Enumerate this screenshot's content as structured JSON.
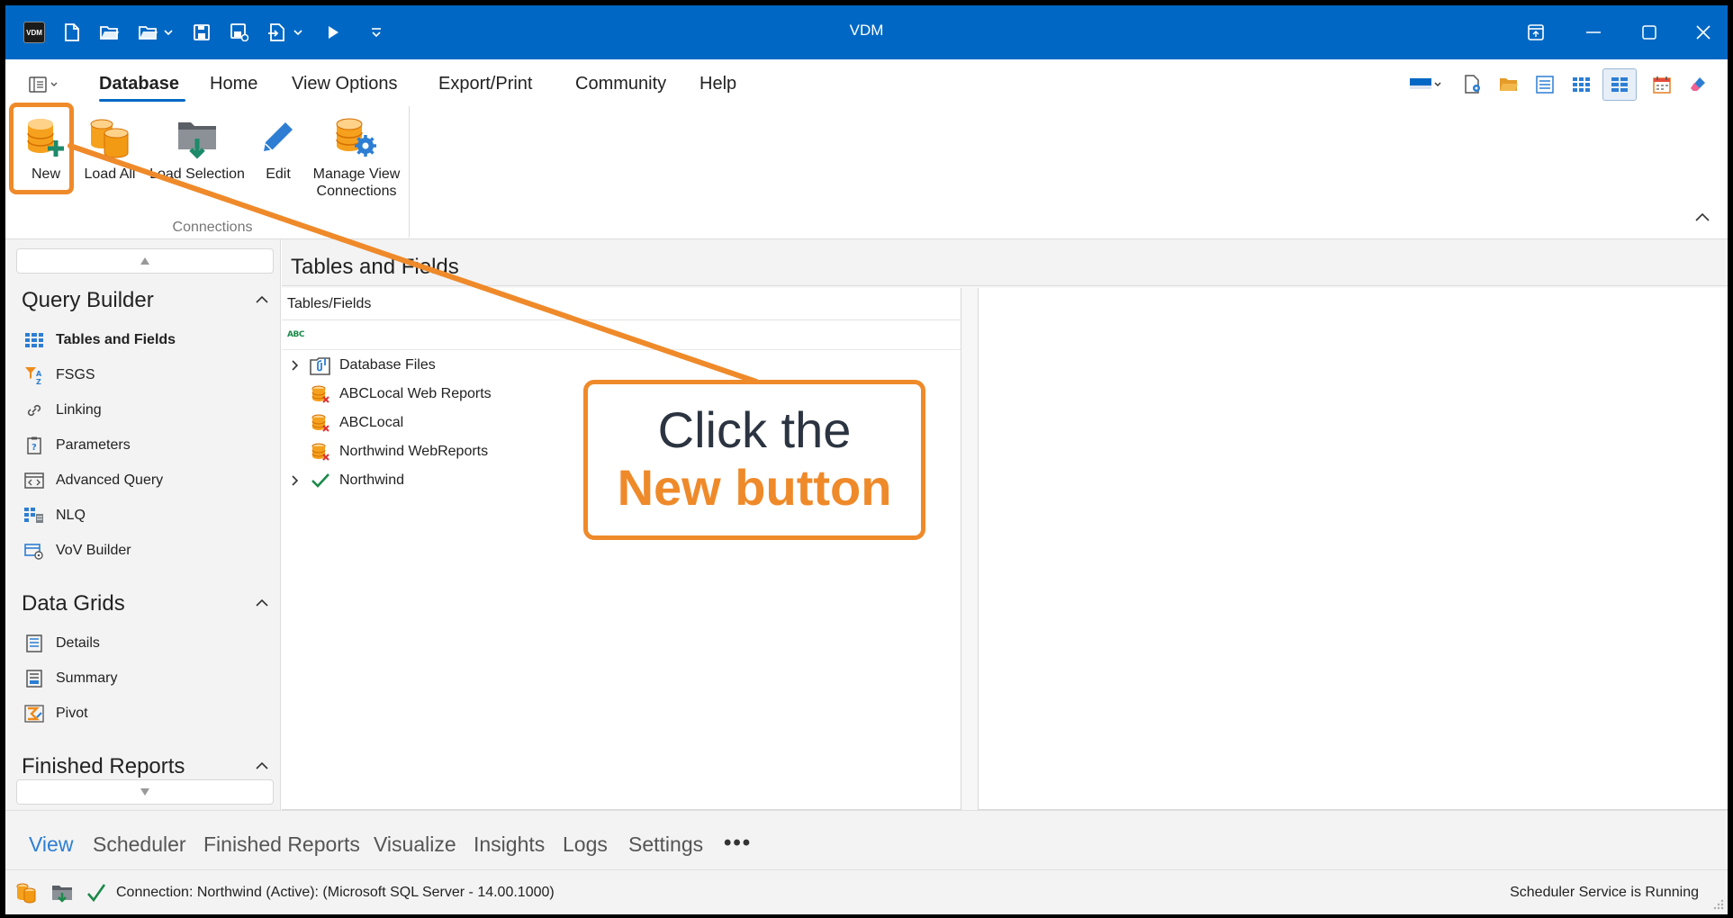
{
  "window": {
    "title": "VDM",
    "app_logo": "VDM"
  },
  "ribbon_tabs": [
    {
      "label": "Database"
    },
    {
      "label": "Home"
    },
    {
      "label": "View Options"
    },
    {
      "label": "Export/Print"
    },
    {
      "label": "Community"
    },
    {
      "label": "Help"
    }
  ],
  "ribbon": {
    "buttons": [
      {
        "label": "New"
      },
      {
        "label": "Load All"
      },
      {
        "label": "Load Selection"
      },
      {
        "label": "Edit"
      },
      {
        "label": "Manage View",
        "label2": "Connections"
      }
    ],
    "group_label": "Connections"
  },
  "nav": {
    "sections": [
      {
        "title": "Query Builder",
        "items": [
          "Tables and Fields",
          "FSGS",
          "Linking",
          "Parameters",
          "Advanced Query",
          "NLQ",
          "VoV Builder"
        ]
      },
      {
        "title": "Data Grids",
        "items": [
          "Details",
          "Summary",
          "Pivot"
        ]
      },
      {
        "title": "Finished Reports"
      }
    ]
  },
  "main": {
    "title": "Tables and Fields",
    "tree_header": "Tables/Fields",
    "filter_icon_text": "ABC",
    "tree": [
      {
        "label": "Database Files",
        "expandable": true
      },
      {
        "label": "ABCLocal Web Reports",
        "expandable": false
      },
      {
        "label": "ABCLocal",
        "expandable": false
      },
      {
        "label": "Northwind WebReports",
        "expandable": false
      },
      {
        "label": "Northwind",
        "expandable": true
      }
    ]
  },
  "modules": [
    "View",
    "Scheduler",
    "Finished Reports",
    "Visualize",
    "Insights",
    "Logs",
    "Settings"
  ],
  "more": "•••",
  "status": {
    "connection": "Connection: Northwind (Active): (Microsoft SQL Server - 14.00.1000)",
    "scheduler": "Scheduler Service is Running"
  },
  "callout": {
    "line1": "Click the",
    "line2": "New button"
  },
  "colors": {
    "titlebar": "#0068c4",
    "accent_orange": "#ef8a2a",
    "active_module": "#2d7ed3",
    "check_green": "#1a8a4a"
  }
}
